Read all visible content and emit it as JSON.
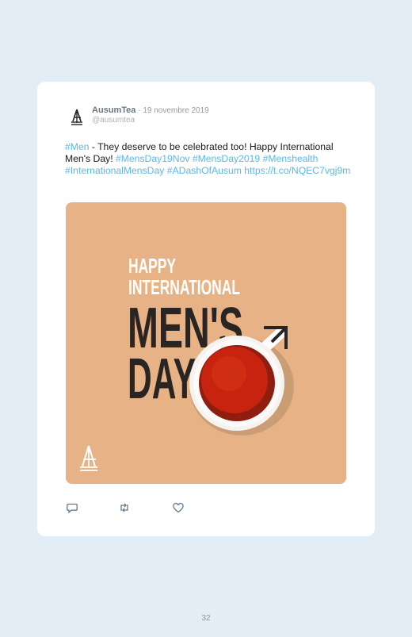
{
  "tweet": {
    "name": "AusumTea",
    "separator": "·",
    "date": "19 novembre 2019",
    "handle": "@ausumtea",
    "text_segments": [
      {
        "text": "#Men",
        "type": "hashtag"
      },
      {
        "text": " - They deserve to be celebrated too! Happy International Men's Day! ",
        "type": "text"
      },
      {
        "text": "#MensDay19Nov",
        "type": "hashtag"
      },
      {
        "text": " ",
        "type": "text"
      },
      {
        "text": "#MensDay2019",
        "type": "hashtag"
      },
      {
        "text": " ",
        "type": "text"
      },
      {
        "text": "#Menshealth",
        "type": "hashtag"
      },
      {
        "text": " ",
        "type": "text"
      },
      {
        "text": "#InternationalMensDay",
        "type": "hashtag"
      },
      {
        "text": " ",
        "type": "text"
      },
      {
        "text": "#ADashOfAusum",
        "type": "hashtag"
      },
      {
        "text": " ",
        "type": "text"
      },
      {
        "text": "https://t.co/NQEC7vgj9m",
        "type": "link"
      }
    ]
  },
  "image": {
    "line1": "HAPPY",
    "line2": "INTERNATIONAL",
    "line3": "MEN'S",
    "line4": "DAY",
    "background_color": "#e7b386",
    "text_color": "#2a2522",
    "tea_color": "#b31a0e"
  },
  "actions": [
    {
      "icon": "reply-icon"
    },
    {
      "icon": "retweet-icon"
    },
    {
      "icon": "like-icon"
    }
  ],
  "page_number": "32",
  "colors": {
    "page_bg": "#e3edf5",
    "hashtag": "#5ab8ea",
    "muted": "#8f9aa4"
  }
}
